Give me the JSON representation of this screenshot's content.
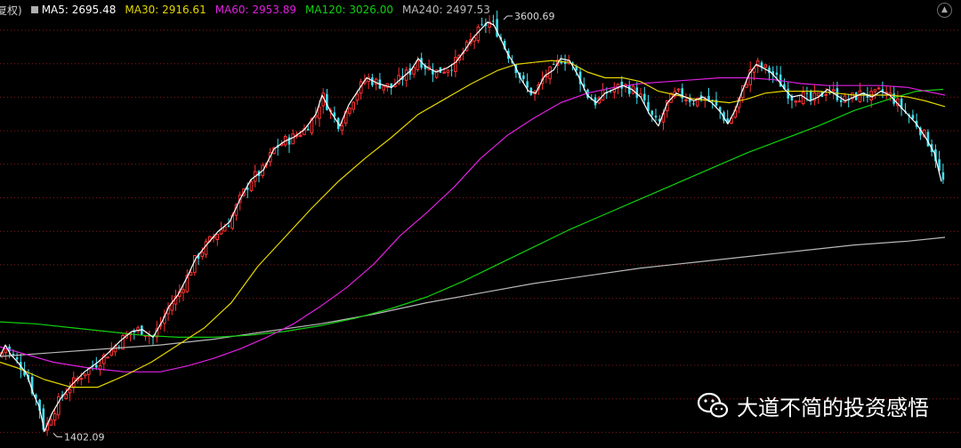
{
  "header": {
    "mode_label": "复权)",
    "collapse_icon": "chevron-up-icon"
  },
  "chart_data": {
    "type": "candlestick",
    "indicators": [
      {
        "name": "MA5",
        "value": "2695.48",
        "color": "#ffffff"
      },
      {
        "name": "MA30",
        "value": "2916.61",
        "color": "#e5d600"
      },
      {
        "name": "MA60",
        "value": "2953.89",
        "color": "#e020e0"
      },
      {
        "name": "MA120",
        "value": "3026.00",
        "color": "#10d010"
      },
      {
        "name": "MA240",
        "value": "2497.53",
        "color": "#b8b8b8"
      }
    ],
    "high_label": "3600.69",
    "low_label": "1402.09",
    "high": 3600.69,
    "low": 1402.09,
    "ylim": [
      1390,
      3610
    ],
    "colors": {
      "up": "#ff3232",
      "down": "#40e0f0",
      "grid": "#8a1a1a"
    },
    "candle_count": 250,
    "close_path": [
      [
        0,
        1820
      ],
      [
        6,
        1880
      ],
      [
        12,
        1830
      ],
      [
        20,
        1790
      ],
      [
        30,
        1730
      ],
      [
        38,
        1620
      ],
      [
        44,
        1560
      ],
      [
        50,
        1430
      ],
      [
        58,
        1520
      ],
      [
        68,
        1600
      ],
      [
        80,
        1670
      ],
      [
        95,
        1740
      ],
      [
        110,
        1790
      ],
      [
        122,
        1840
      ],
      [
        135,
        1900
      ],
      [
        148,
        1950
      ],
      [
        160,
        1960
      ],
      [
        172,
        1920
      ],
      [
        182,
        2000
      ],
      [
        190,
        2080
      ],
      [
        200,
        2140
      ],
      [
        210,
        2230
      ],
      [
        220,
        2330
      ],
      [
        232,
        2400
      ],
      [
        245,
        2470
      ],
      [
        258,
        2520
      ],
      [
        270,
        2640
      ],
      [
        282,
        2740
      ],
      [
        296,
        2790
      ],
      [
        308,
        2900
      ],
      [
        320,
        2940
      ],
      [
        330,
        2960
      ],
      [
        342,
        3000
      ],
      [
        355,
        3080
      ],
      [
        362,
        3180
      ],
      [
        372,
        3090
      ],
      [
        382,
        3020
      ],
      [
        392,
        3130
      ],
      [
        402,
        3200
      ],
      [
        412,
        3270
      ],
      [
        425,
        3240
      ],
      [
        440,
        3220
      ],
      [
        452,
        3270
      ],
      [
        462,
        3310
      ],
      [
        470,
        3370
      ],
      [
        478,
        3330
      ],
      [
        490,
        3300
      ],
      [
        502,
        3320
      ],
      [
        512,
        3350
      ],
      [
        522,
        3410
      ],
      [
        532,
        3480
      ],
      [
        540,
        3520
      ],
      [
        548,
        3560
      ],
      [
        555,
        3545
      ],
      [
        562,
        3480
      ],
      [
        570,
        3400
      ],
      [
        578,
        3340
      ],
      [
        586,
        3260
      ],
      [
        594,
        3200
      ],
      [
        602,
        3190
      ],
      [
        612,
        3280
      ],
      [
        622,
        3310
      ],
      [
        630,
        3370
      ],
      [
        640,
        3360
      ],
      [
        650,
        3280
      ],
      [
        660,
        3180
      ],
      [
        670,
        3140
      ],
      [
        680,
        3190
      ],
      [
        690,
        3210
      ],
      [
        700,
        3230
      ],
      [
        710,
        3210
      ],
      [
        720,
        3170
      ],
      [
        730,
        3080
      ],
      [
        740,
        3020
      ],
      [
        750,
        3140
      ],
      [
        760,
        3190
      ],
      [
        770,
        3170
      ],
      [
        780,
        3150
      ],
      [
        790,
        3170
      ],
      [
        800,
        3140
      ],
      [
        810,
        3090
      ],
      [
        818,
        3030
      ],
      [
        826,
        3100
      ],
      [
        834,
        3200
      ],
      [
        842,
        3290
      ],
      [
        850,
        3340
      ],
      [
        858,
        3320
      ],
      [
        866,
        3300
      ],
      [
        874,
        3260
      ],
      [
        882,
        3210
      ],
      [
        890,
        3170
      ],
      [
        900,
        3180
      ],
      [
        910,
        3150
      ],
      [
        920,
        3170
      ],
      [
        930,
        3210
      ],
      [
        940,
        3180
      ],
      [
        950,
        3150
      ],
      [
        960,
        3170
      ],
      [
        970,
        3190
      ],
      [
        980,
        3170
      ],
      [
        990,
        3200
      ],
      [
        1000,
        3180
      ],
      [
        1010,
        3130
      ],
      [
        1020,
        3080
      ],
      [
        1030,
        3030
      ],
      [
        1040,
        2960
      ],
      [
        1050,
        2880
      ],
      [
        1058,
        2730
      ]
    ],
    "ma_series": [
      {
        "name": "MA30",
        "color": "#e5d600",
        "points": [
          [
            0,
            1790
          ],
          [
            20,
            1760
          ],
          [
            50,
            1700
          ],
          [
            80,
            1660
          ],
          [
            110,
            1660
          ],
          [
            140,
            1720
          ],
          [
            170,
            1790
          ],
          [
            200,
            1880
          ],
          [
            230,
            1970
          ],
          [
            260,
            2100
          ],
          [
            290,
            2290
          ],
          [
            320,
            2440
          ],
          [
            350,
            2590
          ],
          [
            380,
            2730
          ],
          [
            410,
            2850
          ],
          [
            440,
            2960
          ],
          [
            470,
            3080
          ],
          [
            500,
            3160
          ],
          [
            530,
            3240
          ],
          [
            560,
            3310
          ],
          [
            580,
            3340
          ],
          [
            600,
            3350
          ],
          [
            620,
            3360
          ],
          [
            640,
            3350
          ],
          [
            660,
            3300
          ],
          [
            680,
            3270
          ],
          [
            700,
            3270
          ],
          [
            720,
            3250
          ],
          [
            740,
            3200
          ],
          [
            760,
            3180
          ],
          [
            780,
            3160
          ],
          [
            800,
            3150
          ],
          [
            820,
            3140
          ],
          [
            840,
            3160
          ],
          [
            860,
            3190
          ],
          [
            880,
            3200
          ],
          [
            900,
            3200
          ],
          [
            920,
            3200
          ],
          [
            940,
            3190
          ],
          [
            960,
            3180
          ],
          [
            980,
            3180
          ],
          [
            1000,
            3180
          ],
          [
            1020,
            3170
          ],
          [
            1040,
            3150
          ],
          [
            1062,
            3120
          ]
        ]
      },
      {
        "name": "MA60",
        "color": "#e020e0",
        "points": [
          [
            0,
            1870
          ],
          [
            30,
            1830
          ],
          [
            60,
            1790
          ],
          [
            100,
            1760
          ],
          [
            140,
            1740
          ],
          [
            180,
            1740
          ],
          [
            210,
            1770
          ],
          [
            240,
            1810
          ],
          [
            270,
            1860
          ],
          [
            300,
            1920
          ],
          [
            330,
            1990
          ],
          [
            360,
            2080
          ],
          [
            390,
            2180
          ],
          [
            420,
            2300
          ],
          [
            450,
            2450
          ],
          [
            480,
            2570
          ],
          [
            510,
            2700
          ],
          [
            540,
            2850
          ],
          [
            570,
            2970
          ],
          [
            600,
            3060
          ],
          [
            630,
            3140
          ],
          [
            660,
            3190
          ],
          [
            690,
            3220
          ],
          [
            720,
            3240
          ],
          [
            750,
            3250
          ],
          [
            780,
            3260
          ],
          [
            810,
            3270
          ],
          [
            840,
            3270
          ],
          [
            870,
            3260
          ],
          [
            900,
            3240
          ],
          [
            930,
            3230
          ],
          [
            960,
            3230
          ],
          [
            990,
            3230
          ],
          [
            1020,
            3220
          ],
          [
            1040,
            3200
          ],
          [
            1062,
            3180
          ]
        ]
      },
      {
        "name": "MA120",
        "color": "#10d010",
        "points": [
          [
            0,
            2000
          ],
          [
            40,
            1990
          ],
          [
            80,
            1970
          ],
          [
            120,
            1950
          ],
          [
            160,
            1930
          ],
          [
            200,
            1920
          ],
          [
            240,
            1920
          ],
          [
            280,
            1930
          ],
          [
            320,
            1950
          ],
          [
            360,
            1980
          ],
          [
            400,
            2020
          ],
          [
            440,
            2070
          ],
          [
            480,
            2130
          ],
          [
            520,
            2210
          ],
          [
            560,
            2300
          ],
          [
            600,
            2390
          ],
          [
            640,
            2480
          ],
          [
            680,
            2560
          ],
          [
            720,
            2640
          ],
          [
            760,
            2720
          ],
          [
            800,
            2800
          ],
          [
            840,
            2880
          ],
          [
            880,
            2950
          ],
          [
            920,
            3020
          ],
          [
            960,
            3100
          ],
          [
            1000,
            3160
          ],
          [
            1030,
            3200
          ],
          [
            1060,
            3210
          ]
        ]
      },
      {
        "name": "MA240",
        "color": "#b8b8b8",
        "points": [
          [
            0,
            1820
          ],
          [
            60,
            1840
          ],
          [
            120,
            1860
          ],
          [
            180,
            1880
          ],
          [
            240,
            1910
          ],
          [
            300,
            1950
          ],
          [
            360,
            1990
          ],
          [
            420,
            2040
          ],
          [
            480,
            2100
          ],
          [
            540,
            2150
          ],
          [
            600,
            2200
          ],
          [
            660,
            2240
          ],
          [
            720,
            2280
          ],
          [
            780,
            2310
          ],
          [
            840,
            2340
          ],
          [
            900,
            2370
          ],
          [
            960,
            2400
          ],
          [
            1020,
            2420
          ],
          [
            1062,
            2440
          ]
        ]
      }
    ]
  },
  "watermark": {
    "text": "大道不简的投资感悟",
    "icon": "wechat-icon"
  }
}
